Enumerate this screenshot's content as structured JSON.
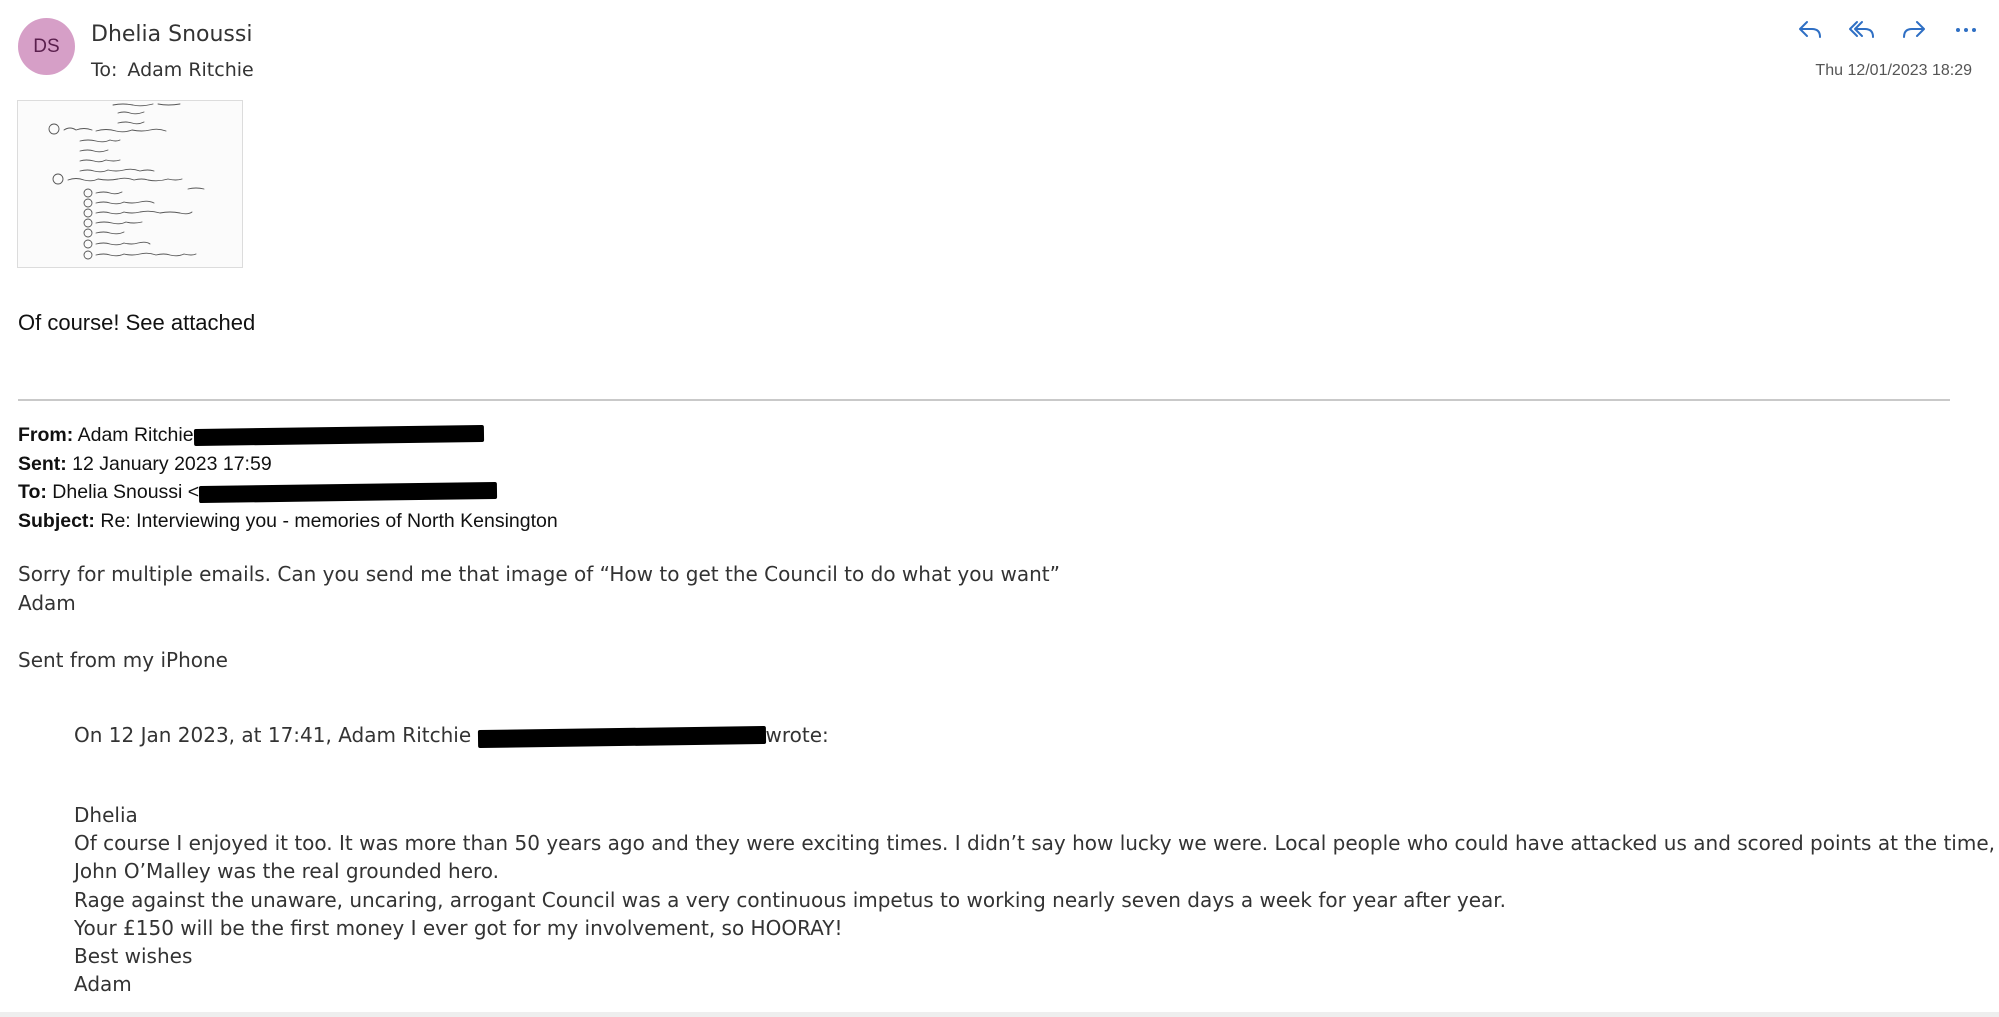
{
  "header": {
    "avatar_initials": "DS",
    "sender_name": "Dhelia Snoussi",
    "to_label": "To:",
    "to_name": "Adam Ritchie",
    "date": "Thu 12/01/2023 18:29",
    "actions": [
      "reply-icon",
      "reply-all-icon",
      "forward-icon",
      "more-icon"
    ]
  },
  "attachment": {
    "type": "handwritten-notes-image",
    "lines": [
      "- 8 weeks",
      "- 25 or so?",
      "(3) Planning by local people",
      "- Campaign report",
      "- Public meeting",
      "- Maps in public places",
      "- Use of mass actions for publicity",
      "(4) How to get the local authority to do what you want",
      "(1) Prepare plans",
      "(2) Get local support & participation",
      "(3) See your council & find out their plans or not",
      "(4) Information - use networks",
      "(5) Publicity is useful",
      "(6) Confront the opposition",
      "(7) Work on every level at the same time"
    ]
  },
  "reply": {
    "text": "Of course! See attached"
  },
  "forwarded": {
    "from_label": "From:",
    "from_value": "Adam Ritchie",
    "sent_label": "Sent:",
    "sent_value": "12 January 2023 17:59",
    "to_label": "To:",
    "to_value": "Dhelia Snoussi <",
    "subject_label": "Subject:",
    "subject_value": "Re: Interviewing you - memories of North Kensington"
  },
  "message": {
    "lines": [
      "Sorry for multiple emails. Can you send me that image of “How to get the Council to do what you want”",
      "Adam"
    ],
    "signature": "Sent from my iPhone"
  },
  "quoted": {
    "intro_prefix": "On 12 Jan 2023, at 17:41, Adam Ritchie",
    "intro_suffix": "wrote:",
    "lines": [
      "Dhelia",
      "Of course I enjoyed it too. It was more than 50 years ago and they were exciting times. I didn’t say how lucky we were. Local people who could have attacked us and scored points at the time, didn’t.",
      "John O’Malley was the real grounded hero.",
      "Rage against the unaware, uncaring, arrogant Council was a very continuous impetus to working nearly seven days a week for year after year.",
      "Your £150 will be the first money I ever got for my involvement, so HOORAY!",
      "Best wishes",
      "Adam"
    ]
  }
}
